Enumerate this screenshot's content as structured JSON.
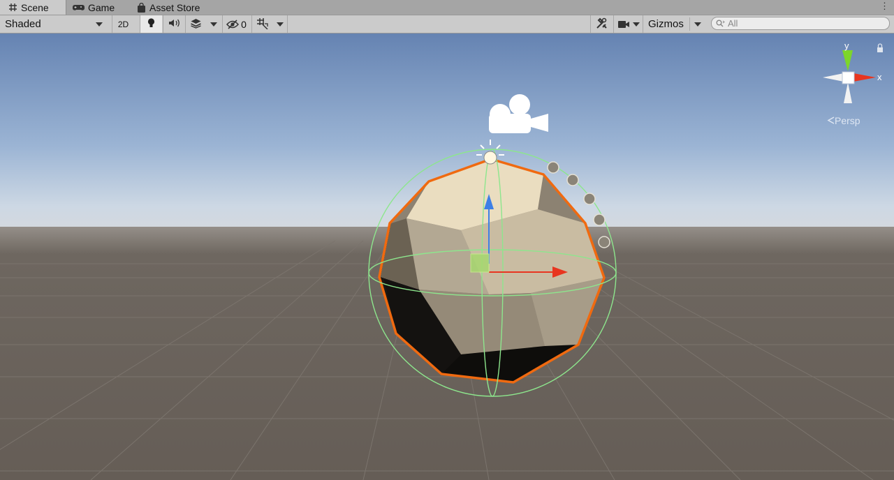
{
  "tabs": [
    {
      "label": "Scene",
      "icon": "grid-icon",
      "active": true
    },
    {
      "label": "Game",
      "icon": "gamepad-icon",
      "active": false
    },
    {
      "label": "Asset Store",
      "icon": "shopping-bag-icon",
      "active": false
    }
  ],
  "toolbar": {
    "draw_mode": "Shaded",
    "mode_2d": "2D",
    "hidden_count": "0",
    "gizmos": "Gizmos",
    "search_placeholder": "All"
  },
  "gizmo": {
    "y_label": "y",
    "x_label": "x",
    "projection": "Persp"
  },
  "colors": {
    "selection_outline": "#f06a10",
    "collider": "#8de68d",
    "axis_y": "#7dd62a",
    "axis_x": "#e8351f",
    "axis_z": "#3e7fe6",
    "sky_top": "#6585b3",
    "ground": "#666058"
  }
}
